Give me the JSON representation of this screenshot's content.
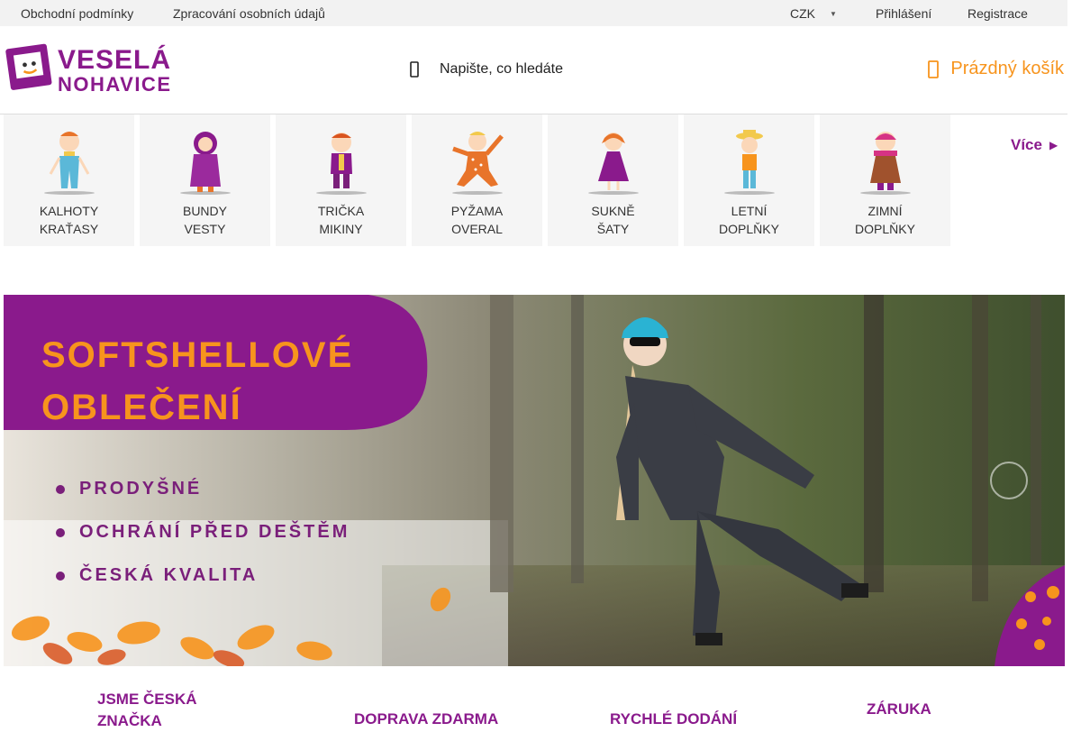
{
  "topbar": {
    "terms": "Obchodní podmínky",
    "privacy": "Zpracování osobních údajů",
    "currency": "CZK",
    "login": "Přihlášení",
    "register": "Registrace"
  },
  "header": {
    "logo_text": "VESELÁ NOHAVICE",
    "search_placeholder": "Napište, co hledáte",
    "cart_label": "Prázdný košík"
  },
  "categories": [
    {
      "line1": "KALHOTY",
      "line2": "KRAŤASY"
    },
    {
      "line1": "BUNDY",
      "line2": "VESTY"
    },
    {
      "line1": "TRIČKA",
      "line2": "MIKINY"
    },
    {
      "line1": "PYŽAMA",
      "line2": "OVERAL"
    },
    {
      "line1": "SUKNĚ",
      "line2": "ŠATY"
    },
    {
      "line1": "LETNÍ",
      "line2": "DOPLŇKY"
    },
    {
      "line1": "ZIMNÍ",
      "line2": "DOPLŇKY"
    }
  ],
  "more_label": "Více",
  "banner": {
    "headline_1": "SOFTSHELLOVÉ",
    "headline_2": "OBLEČENÍ",
    "bullets": [
      "PRODYŠNÉ",
      "OCHRÁNÍ PŘED DEŠTĚM",
      "ČESKÁ KVALITA"
    ]
  },
  "benefits": {
    "b1_line1": "JSME ČESKÁ",
    "b1_line2": "ZNAČKA",
    "b2": "DOPRAVA ZDARMA",
    "b3": "RYCHLÉ DODÁNÍ",
    "b4": "ZÁRUKA"
  },
  "colors": {
    "brand_purple": "#8a1a8c",
    "brand_orange": "#f7941d",
    "topbar_bg": "#f2f2f2",
    "tile_bg": "#f5f5f5"
  },
  "icons": {
    "search": "search-icon",
    "cart": "cart-icon",
    "currency_caret": "caret-down-icon",
    "more_chevron": "chevron-right-icon",
    "banner_next": "carousel-next-icon"
  }
}
